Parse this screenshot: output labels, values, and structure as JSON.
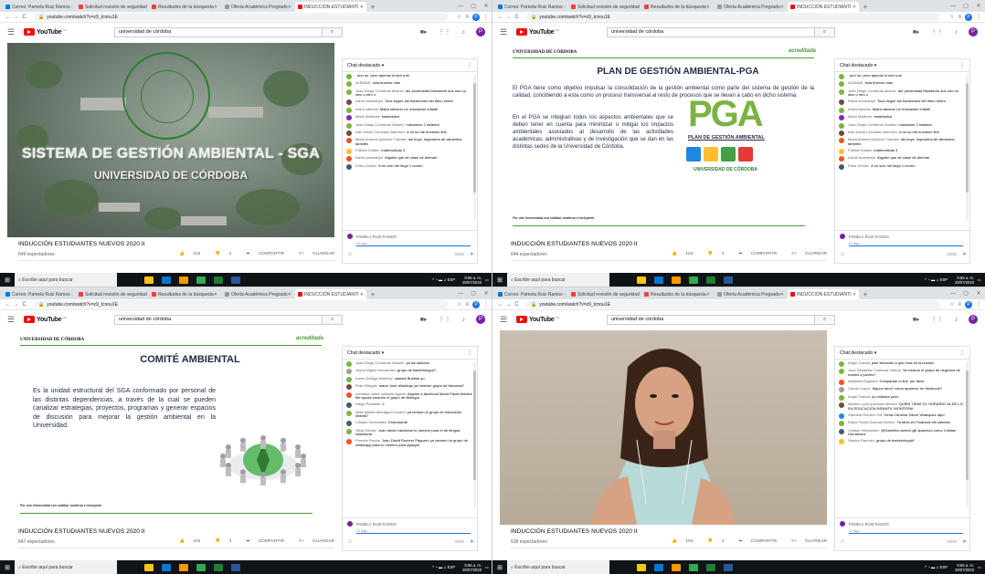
{
  "browser": {
    "tabs": [
      {
        "label": "Correo: Pamela Ruiz Ramos - C",
        "color": "#0078d4"
      },
      {
        "label": "Solicitud revisión de seguridad",
        "color": "#ea4335"
      },
      {
        "label": "Resultados de la búsqueda",
        "color": "#ea4335"
      },
      {
        "label": "Oferta Académica Pregrado",
        "color": "#999999"
      },
      {
        "label": "INDUCCIÓN ESTUDIANTI",
        "color": "#ff0000"
      }
    ],
    "url": "youtube.com/watch?v=z9_tcnou1E",
    "profile_initial": "P"
  },
  "youtube": {
    "logo_text": "YouTube",
    "logo_country": "CO",
    "search_value": "universidad de córdoba"
  },
  "panels": [
    {
      "slide": "sga",
      "slide_text": {
        "title": "SISTEMA DE GESTIÓN AMBIENTAL - SGA",
        "subtitle": "UNIVERSIDAD DE CÓRDOBA"
      },
      "video_title": "INDUCCIÓN ESTUDIANTES NUEVOS 2020 II",
      "views": "649 espectadores",
      "likes": "102",
      "dislikes": "4",
      "share": "COMPARTIR",
      "save": "GUARDAR",
      "chat": [
        {
          "author": "",
          "text": "aún no, pero apenas lo sea a mí",
          "color": "#7cb342"
        },
        {
          "author": "ALEMAN",
          "text": "hola buenos días",
          "color": "#7cb342"
        },
        {
          "author": "Juan Diego Contreras álvarez",
          "text": "ahí próximidad Mandame dos uno no sino o otro o",
          "color": "#7cb342"
        },
        {
          "author": "David sanmartyn",
          "text": "Toca seguir las tradiciones del ritmo motor",
          "color": "#6d4c41"
        },
        {
          "author": "maira salcedo",
          "text": "Maira salcedo Lic educación infantil",
          "color": "#7cb342"
        },
        {
          "author": "Mario Martínez",
          "text": "estadística",
          "color": "#8e24aa"
        },
        {
          "author": "Juan Diego Contreras Álvarez",
          "text": "mandaron 2 sistema",
          "color": "#7cb342"
        },
        {
          "author": "Ivan David Coronado Martínez",
          "text": "a mi no me enviaron link",
          "color": "#6d4c41"
        },
        {
          "author": "Maria Andrea Quintero Fuentes",
          "text": "las hoye, Ingeniería de alimentos también",
          "color": "#f4511e"
        },
        {
          "author": "Fulbion Ibañez",
          "text": "matemáticas 3",
          "color": "#fbc02d"
        },
        {
          "author": "David sanmartyn",
          "text": "Alguien que de clase de Alemán",
          "color": "#f4511e"
        },
        {
          "author": "Eriko Gómez",
          "text": "A mí solo me llegó 1 correo",
          "color": "#455a64"
        }
      ]
    },
    {
      "slide": "pga",
      "slide_text": {
        "university": "UNIVERSIDAD DE CÓRDOBA",
        "accredit": "acreditada",
        "heading": "PLAN DE GESTIÓN AMBIENTAL-PGA",
        "p1": "El PGA tiene como objetivo impulsar la consolidación de la gestión ambiental como parte del sistema de gestión de la calidad, concibiendo a esta como un proceso transversal al resto de procesos que se llevan a cabo en dicho sistema.",
        "p2": "En el PGA se integran todos los aspectos ambientales que se deben tener en cuenta para minimizar o mitigar los impactos ambientales asociados al desarrollo de las actividades académicas, administrativas y de investigación que se dan en las distintas sedes de la Universidad de Córdoba.",
        "logo": "PGA",
        "logo_label": "PLAN DE GESTIÓN AMBIENTAL",
        "logo_uni": "UNIVERSIDAD DE CÓRDOBA",
        "footer": "Por una Universidad con calidad, moderna e incluyente"
      },
      "video_title": "INDUCCIÓN ESTUDIANTES NUEVOS 2020 II",
      "views": "644 espectadores",
      "likes": "103",
      "dislikes": "4",
      "share": "COMPARTIR",
      "save": "GUARDAR",
      "chat": [
        {
          "author": "",
          "text": "aún no, pero apenas lo sea a mí",
          "color": "#7cb342"
        },
        {
          "author": "ALEMAN",
          "text": "hola buenos días",
          "color": "#7cb342"
        },
        {
          "author": "Juan Diego Contreras álvarez",
          "text": "ahí próximidad Mandame dos uno no sino o otro o",
          "color": "#7cb342"
        },
        {
          "author": "David sanmartyn",
          "text": "Toca seguir las tradiciones del ritmo motor",
          "color": "#6d4c41"
        },
        {
          "author": "maira salcedo",
          "text": "Maira salcedo Lic educación infantil",
          "color": "#7cb342"
        },
        {
          "author": "Mario Martínez",
          "text": "estadística",
          "color": "#8e24aa"
        },
        {
          "author": "Juan Diego Contreras Álvarez",
          "text": "mandaron 2 sistema",
          "color": "#7cb342"
        },
        {
          "author": "Ivan David Coronado Martínez",
          "text": "a mi no me enviaron link",
          "color": "#6d4c41"
        },
        {
          "author": "Maria Andrea Quintero Fuentes",
          "text": "las hoye, Ingeniería de alimentos también",
          "color": "#f4511e"
        },
        {
          "author": "Fulbion Ibañez",
          "text": "matemáticas 3",
          "color": "#fbc02d"
        },
        {
          "author": "David sanmartyn",
          "text": "Alguien que de clase de Alemán",
          "color": "#f4511e"
        },
        {
          "author": "Eriko Gómez",
          "text": "A mí solo me llegó 1 correo",
          "color": "#455a64"
        }
      ]
    },
    {
      "slide": "comite",
      "slide_text": {
        "university": "UNIVERSIDAD DE CÓRDOBA",
        "accredit": "acreditada",
        "heading": "COMITÉ AMBIENTAL",
        "p1": "Es la unidad estructural del SGA conformado por personal de las distintas dependencias, a través de la cual se pueden canalizar estrategias, proyectos, programas y generar espacios de discusión para mejorar la gestión ambiental en la Universidad.",
        "footer": "Por una Universidad con calidad, moderna e incluyente"
      },
      "video_title": "INDUCCIÓN ESTUDIANTES NUEVOS 2020 II",
      "views": "647 espectadores",
      "likes": "104",
      "dislikes": "4",
      "share": "COMPARTIR",
      "save": "GUARDAR",
      "chat": [
        {
          "author": "Juan Diego Contreras Álvarez",
          "text": "ya los saludos",
          "color": "#7cb342"
        },
        {
          "author": "Jesus Miguel Hernández",
          "text": "grupo de bacteriología?",
          "color": "#9e9e9e"
        },
        {
          "author": "Karen Zúñiga Martínez",
          "text": "camela Buebas yo",
          "color": "#7cb342"
        },
        {
          "author": "Fidel Villegas",
          "text": "maria José villadiego ya hicieron grupo de farmacia?",
          "color": "#6d4c41"
        },
        {
          "author": "cortadas maria mustafa higado",
          "text": "Alguien a facebook Maria Paula Montes Me ayuda creando el grupo de Biología",
          "color": "#f4511e"
        },
        {
          "author": "Diego Podadas",
          "text": "2",
          "color": "#455a64"
        },
        {
          "author": "linda adriela arbeaguer romero",
          "text": "ya crearon el grupo de educación infantil?",
          "color": "#7cb342"
        },
        {
          "author": "Cristian Hernández",
          "text": "Estuvisante",
          "color": "#455a64"
        },
        {
          "author": "Silba Gómez",
          "text": "Juan david mandame tu número para el de lengua castellana",
          "color": "#7cb342"
        },
        {
          "author": "Pamela Pacióa",
          "text": "Juan David Romero Paguero ya crearon un grupo de whatsapp pasa tu número para agregar",
          "color": "#f4511e"
        }
      ]
    },
    {
      "slide": "person",
      "slide_text": {},
      "video_title": "INDUCCIÓN ESTUDIANTES NUEVOS 2020 II",
      "views": "638 espectadores",
      "likes": "104",
      "dislikes": "4",
      "share": "COMPARTIR",
      "save": "GUARDAR",
      "chat": [
        {
          "author": "Angie Gaviria",
          "text": "jose fernando a que hora es la reunion",
          "color": "#7cb342"
        },
        {
          "author": "Juan Sebastián Cardona Galeza",
          "text": "Ya crearon el grupo de negocios de martes a jueves?",
          "color": "#7cb342"
        },
        {
          "author": "Alejandra Agamez",
          "text": "Compartan el link, por favor",
          "color": "#f4511e"
        },
        {
          "author": "Camilo Lopez",
          "text": "Alguno sera? como aparecer en facebook?",
          "color": "#9e9e9e"
        },
        {
          "author": "Angie Gaviria",
          "text": "yo doblada poco",
          "color": "#7cb342"
        },
        {
          "author": "Martha Lucia guerdan Herrera",
          "text": "QUIEN TIENE EL HORARIO 1A DE LIC EN EDUCACIÓN INFANTIL MONTERIA",
          "color": "#6d4c41"
        },
        {
          "author": "Gabriela Romero Gill",
          "text": "Gena Carolina Tobon Velasquez aquí",
          "color": "#1e88e5"
        },
        {
          "author": "Diana Paola Guzman Morelo",
          "text": "Ya tanin en Finanzas los saludos",
          "color": "#7cb342"
        },
        {
          "author": "Cristian Hernández",
          "text": "@Gabriela romero gill aparezco como Cristian Hernández",
          "color": "#455a64"
        },
        {
          "author": "Sandra Ramírez",
          "text": "grupo de bacteriología?",
          "color": "#fbc02d"
        }
      ]
    }
  ],
  "chat_ui": {
    "header": "Chat destacado",
    "user": "PAMELA RUIZ RAMOS",
    "placeholder": "Di algo...",
    "count": "0/200"
  },
  "taskbar": {
    "search_placeholder": "Escribe aquí para buscar",
    "time": "9:56 a. m.",
    "date": "29/07/2020"
  }
}
